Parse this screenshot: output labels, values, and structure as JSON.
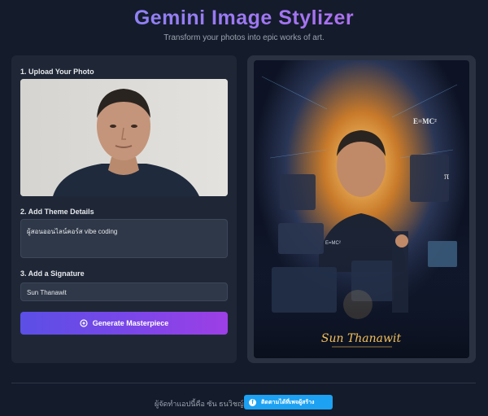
{
  "header": {
    "title": "Gemini Image Stylizer",
    "subtitle": "Transform your photos into epic works of art."
  },
  "form": {
    "step1_label": "1. Upload Your Photo",
    "step2_label": "2. Add Theme Details",
    "theme_value": "ผู้สอนออนไลน์คอร์ส vibe coding",
    "step3_label": "3. Add a Signature",
    "signature_value": "Sun Thanawit",
    "generate_label": "Generate Masterpiece"
  },
  "result": {
    "overlay_formula_1": "E=MC²",
    "overlay_formula_2": "E=MC²",
    "overlay_pi": "π",
    "overlay_signature": "Sun Thanawit"
  },
  "footer": {
    "credit": "ผู้จัดทำแอปนี้คือ ซัน ธนวิชญ์",
    "facebook_label": "ติดตามได้ที่เพจผู้สร้าง"
  },
  "colors": {
    "background": "#141b2b",
    "panel": "#1f2737",
    "accent_start": "#5b4fe6",
    "accent_end": "#9d3fe6",
    "facebook_button": "#1da1f2"
  },
  "icons": {
    "generate": "sparkle-icon",
    "facebook": "facebook-icon"
  }
}
